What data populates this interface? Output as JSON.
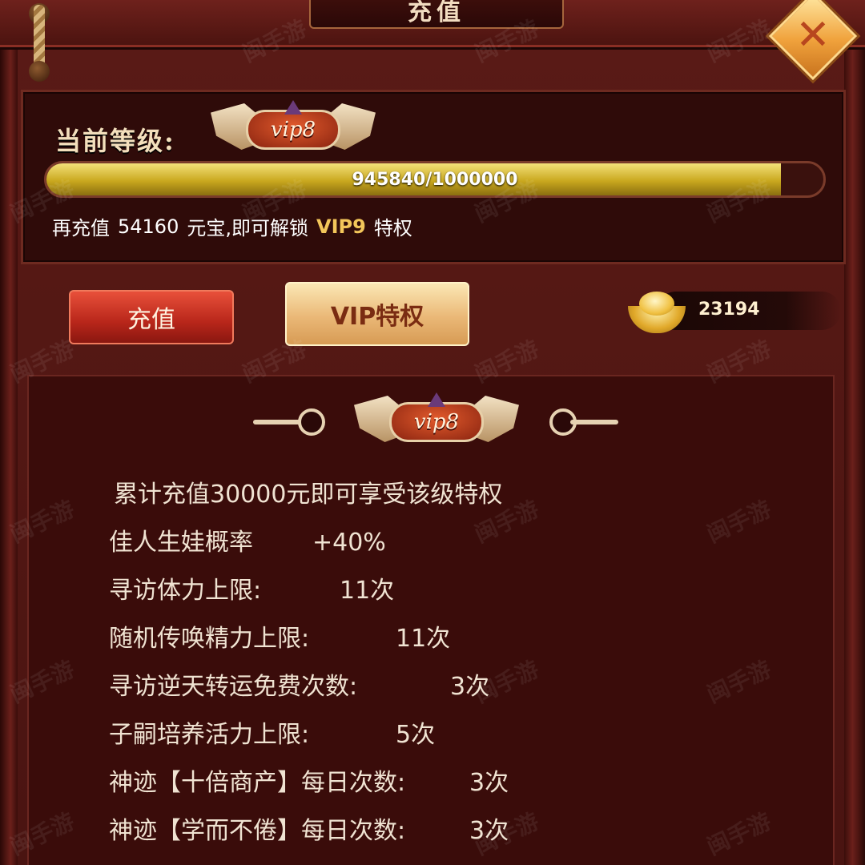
{
  "window": {
    "title": "充值",
    "close_icon": "close-icon"
  },
  "vip_panel": {
    "level_label": "当前等级:",
    "badge_text": "vip8",
    "progress_text": "945840/1000000",
    "progress_fraction": 0.9458,
    "unlock_prefix": "再充值",
    "unlock_amount": "54160",
    "unlock_middle": "元宝,即可解锁",
    "unlock_vip": "VIP9",
    "unlock_suffix": "特权"
  },
  "tabs": {
    "recharge_label": "充值",
    "vip_label": "VIP特权"
  },
  "currency": {
    "icon": "gold-ingot-icon",
    "amount": "23194"
  },
  "privileges": {
    "badge_text": "vip8",
    "requirement": "累计充值30000元即可享受该级特权",
    "rows": [
      {
        "label": "佳人生娃概率",
        "value": "+40%"
      },
      {
        "label": "寻访体力上限:",
        "value": "11次"
      },
      {
        "label": "随机传唤精力上限:",
        "value": "11次"
      },
      {
        "label": "寻访逆天转运免费次数:",
        "value": "3次"
      },
      {
        "label": "子嗣培养活力上限:",
        "value": "5次"
      },
      {
        "label": "神迹【十倍商产】每日次数:",
        "value": "3次"
      },
      {
        "label": "神迹【学而不倦】每日次数:",
        "value": "3次"
      }
    ]
  },
  "watermark": "闽手游"
}
